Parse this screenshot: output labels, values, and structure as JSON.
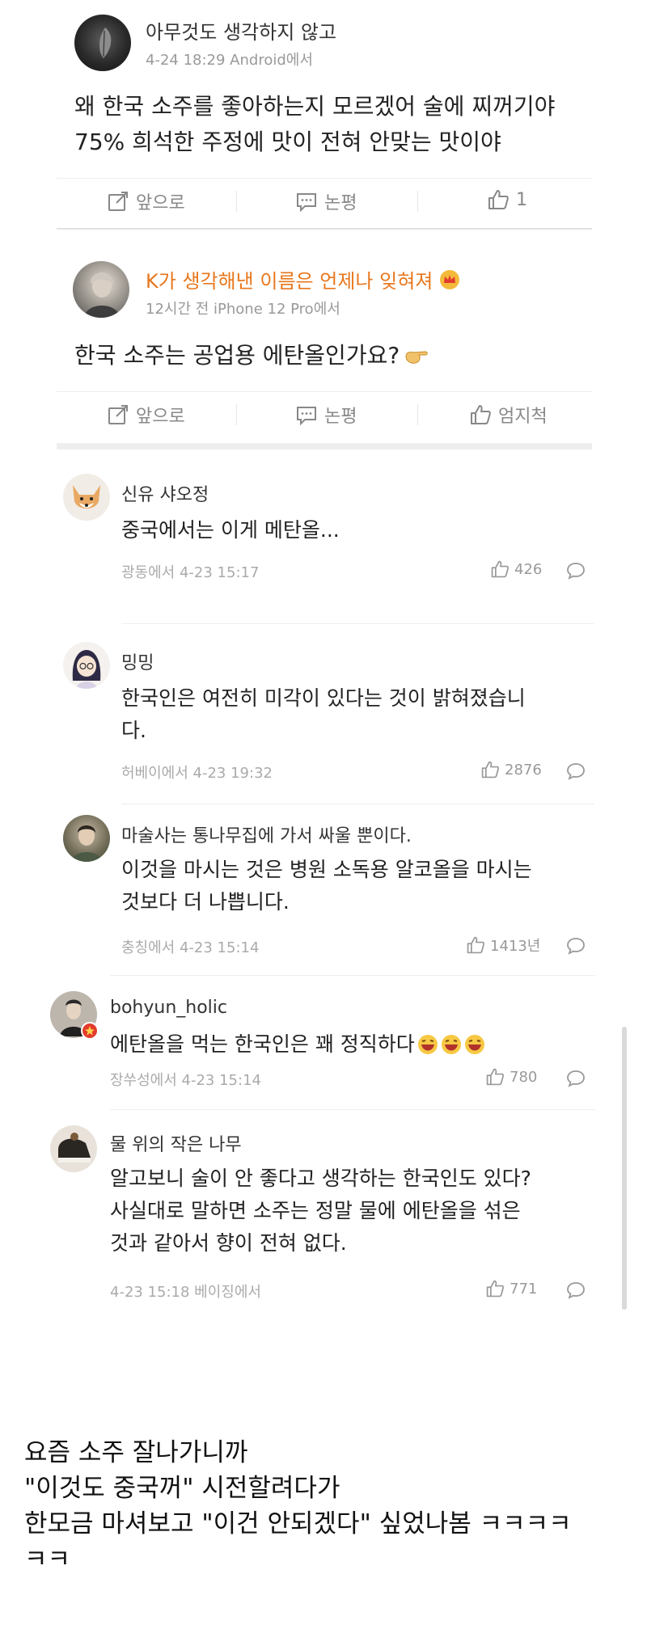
{
  "post1": {
    "username": "아무것도 생각하지 않고",
    "meta": "4-24 18:29 Android에서",
    "body_line1": "왜 한국 소주를 좋아하는지 모르겠어 술에 찌꺼기야",
    "body_line2": "75% 희석한 주정에 맛이 전혀 안맞는 맛이야",
    "actions": {
      "repost": "앞으로",
      "comment": "논평",
      "like": "1"
    }
  },
  "post2": {
    "username": "K가 생각해낸 이름은 언제나 잊혀져",
    "meta": "12시간 전 iPhone 12 Pro에서",
    "body": "한국 소주는 공업용 에탄올인가요?",
    "actions": {
      "repost": "앞으로",
      "comment": "논평",
      "like": "엄지척"
    }
  },
  "comments": [
    {
      "name": "신유 샤오정",
      "body": [
        "중국에서는 이게 메탄올..."
      ],
      "meta": "광동에서 4-23 15:17",
      "likes": "426"
    },
    {
      "name": "밍밍",
      "body": [
        "한국인은 여전히 미각이 있다는 것이 밝혀졌습니",
        "다."
      ],
      "meta": "허베이에서 4-23 19:32",
      "likes": "2876"
    },
    {
      "name": "마술사는 통나무집에 가서 싸울 뿐이다.",
      "body": [
        "이것을 마시는 것은 병원 소독용 알코올을 마시는",
        "것보다 더 나쁩니다."
      ],
      "meta": "충칭에서 4-23 15:14",
      "likes": "1413년"
    },
    {
      "name": "bohyun_holic",
      "body": [
        "에탄올을 먹는 한국인은 꽤 정직하다"
      ],
      "meta": "장쑤성에서 4-23 15:14",
      "likes": "780"
    },
    {
      "name": "물 위의 작은 나무",
      "body": [
        "알고보니 술이 안 좋다고 생각하는 한국인도 있다?",
        "사실대로 말하면 소주는 정말 물에 에탄올을 섞은",
        "것과 같아서 향이 전혀 없다."
      ],
      "meta": "4-23 15:18 베이징에서",
      "likes": "771"
    }
  ],
  "caption": {
    "line1": "요즘 소주 잘나가니까",
    "line2": "\"이것도 중국꺼\" 시전할려다가",
    "line3": "한모금 마셔보고 \"이건 안되겠다\" 싶었나봄 ㅋㅋㅋㅋ",
    "line4": "ㅋㅋ"
  },
  "icons": {
    "repost": "share-edit-icon",
    "comment": "comment-bubble-icon",
    "like": "thumbs-up-icon",
    "reply": "reply-bubble-icon",
    "crown": "crown-badge-icon",
    "emoji": "laughing-face-icon",
    "hand": "pointing-hand-icon"
  },
  "colors": {
    "accent_name": "#e8771d",
    "verified_badge": "#e23b2e"
  }
}
